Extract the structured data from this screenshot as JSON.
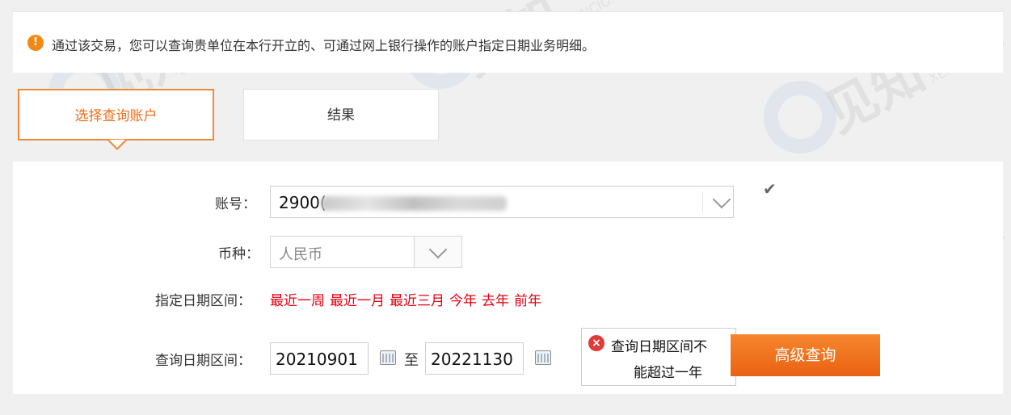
{
  "notice": {
    "icon": "info-icon",
    "text": "通过该交易，您可以查询贵单位在本行开立的、可通过网上银行操作的账户指定日期业务明细。"
  },
  "tabs": [
    {
      "label": "选择查询账户",
      "active": true
    },
    {
      "label": "结果",
      "active": false
    }
  ],
  "form": {
    "account_label": "账号：",
    "account_value": "2900(",
    "currency_label": "币种：",
    "currency_value": "人民币",
    "range_label": "指定日期区间：",
    "quick_ranges": [
      "最近一周",
      "最近一月",
      "最近三月",
      "今年",
      "去年",
      "前年"
    ],
    "query_label": "查询日期区间：",
    "start_date": "20210901",
    "to_label": "至",
    "end_date": "20221130"
  },
  "error": {
    "line1": "查询日期区间不",
    "line2": "能超过一年"
  },
  "buttons": {
    "advanced_search": "高级查询"
  },
  "watermark": {
    "text": "见知",
    "sub": "XENCIO.COM"
  },
  "colors": {
    "accent": "#f06d1a",
    "link_red": "#e60012",
    "button": "#ea6212"
  }
}
